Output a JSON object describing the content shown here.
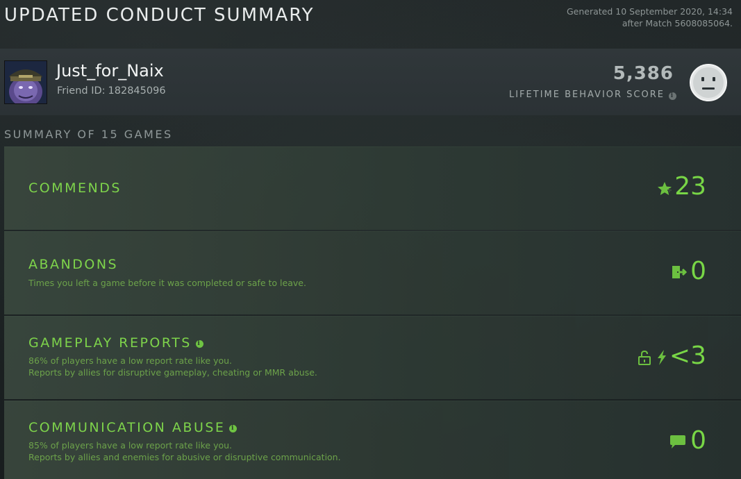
{
  "header": {
    "title": "UPDATED CONDUCT SUMMARY",
    "generated_line1": "Generated 10 September 2020, 14:34",
    "generated_line2": "after Match 5608085064."
  },
  "player": {
    "name": "Just_for_Naix",
    "friend_id_label": "Friend ID:",
    "friend_id": "182845096",
    "score": "5,386",
    "score_label": "LIFETIME BEHAVIOR SCORE"
  },
  "summary": {
    "heading": "SUMMARY OF 15 GAMES"
  },
  "cards": {
    "commends": {
      "title": "COMMENDS",
      "value": "23",
      "icon": "star-icon"
    },
    "abandons": {
      "title": "ABANDONS",
      "desc1": "Times you left a game before it was completed or safe to leave.",
      "value": "0",
      "icon": "exit-door-icon"
    },
    "gameplay_reports": {
      "title": "GAMEPLAY REPORTS",
      "desc1": "86% of players have a low report rate like you.",
      "desc2": "Reports by allies for disruptive gameplay, cheating or MMR abuse.",
      "value": "<3",
      "icons": [
        "unlock-icon",
        "lightning-icon"
      ]
    },
    "communication_abuse": {
      "title": "COMMUNICATION ABUSE",
      "desc1": "85% of players have a low report rate like you.",
      "desc2": "Reports by allies and enemies for abusive or disruptive communication.",
      "value": "0",
      "icon": "chat-bubble-icon"
    }
  },
  "colors": {
    "accent_green": "#7ed44b",
    "desc_green": "#6ca24a",
    "title_white": "#e9ecec"
  }
}
